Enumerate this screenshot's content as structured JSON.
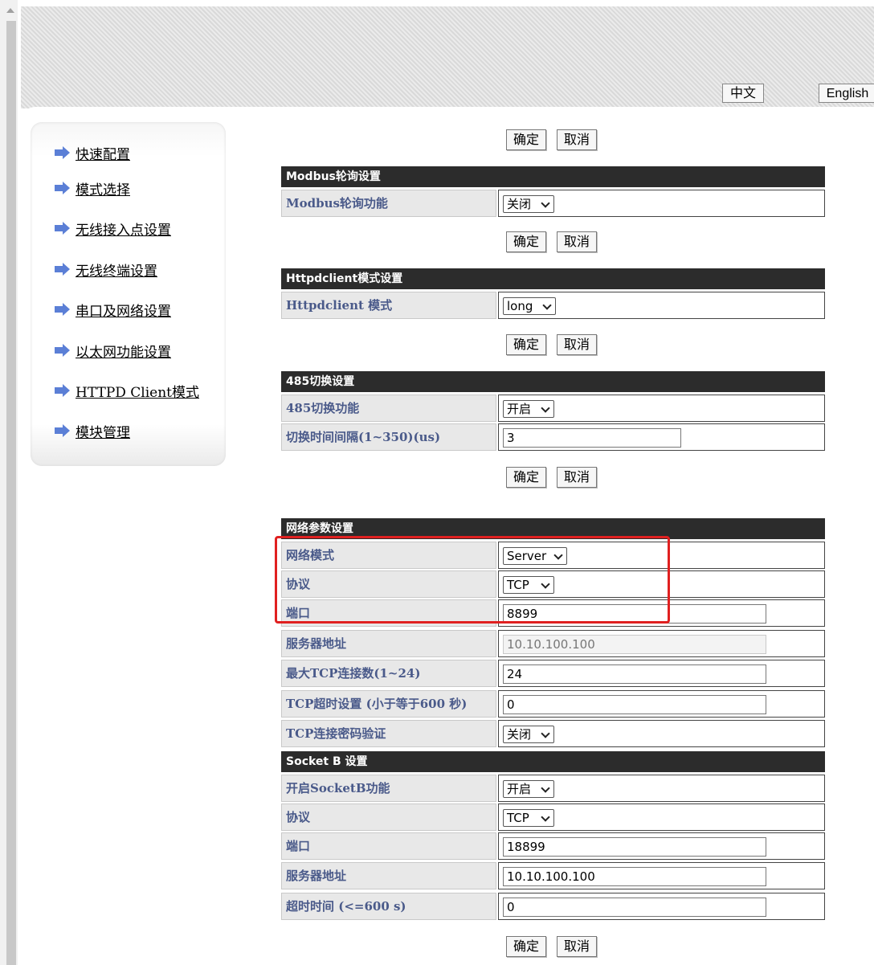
{
  "header": {
    "lang_zh": "中文",
    "lang_en": "English"
  },
  "sidebar": {
    "items": [
      {
        "label": "快速配置"
      },
      {
        "label": "模式选择"
      },
      {
        "label": "无线接入点设置"
      },
      {
        "label": "无线终端设置"
      },
      {
        "label": "串口及网络设置"
      },
      {
        "label": "以太网功能设置"
      },
      {
        "label": "HTTPD Client模式"
      },
      {
        "label": "模块管理"
      }
    ]
  },
  "buttons": {
    "ok": "确定",
    "cancel": "取消"
  },
  "modbus": {
    "title": "Modbus轮询设置",
    "poll_label": "Modbus轮询功能",
    "poll_value": "关闭"
  },
  "httpd": {
    "title": "Httpdclient模式设置",
    "mode_label": "Httpdclient 模式",
    "mode_value": "long"
  },
  "rs485": {
    "title": "485切换设置",
    "switch_label": "485切换功能",
    "switch_value": "开启",
    "interval_label": "切换时间间隔(1~350)(us)",
    "interval_value": "3"
  },
  "network": {
    "title": "网络参数设置",
    "mode_label": "网络模式",
    "mode_value": "Server",
    "protocol_label": "协议",
    "protocol_value": "TCP",
    "port_label": "端口",
    "port_value": "8899",
    "server_label": "服务器地址",
    "server_value": "10.10.100.100",
    "maxconn_label": "最大TCP连接数(1~24)",
    "maxconn_value": "24",
    "timeout_label": "TCP超时设置 (小于等于600 秒)",
    "timeout_value": "0",
    "pwd_label": "TCP连接密码验证",
    "pwd_value": "关闭"
  },
  "socketb": {
    "title": "Socket B 设置",
    "enable_label": "开启SocketB功能",
    "enable_value": "开启",
    "protocol_label": "协议",
    "protocol_value": "TCP",
    "port_label": "端口",
    "port_value": "18899",
    "server_label": "服务器地址",
    "server_value": "10.10.100.100",
    "timeout_label": "超时时间 (<=600 s)",
    "timeout_value": "0"
  },
  "colors": {
    "highlight": "#e02020",
    "section_header": "#2c2c2c",
    "label_text": "#4a5a8a"
  }
}
